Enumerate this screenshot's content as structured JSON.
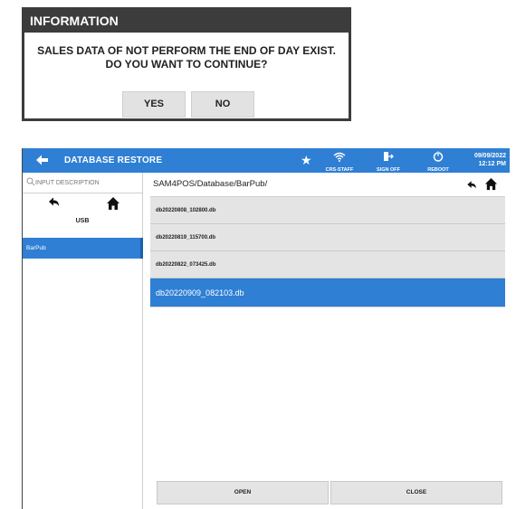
{
  "dialog": {
    "title": "INFORMATION",
    "message_line1": "SALES DATA OF NOT PERFORM THE END OF DAY EXIST.",
    "message_line2": "DO YOU WANT TO CONTINUE?",
    "yes_label": "YES",
    "no_label": "NO"
  },
  "topbar": {
    "title": "DATABASE RESTORE",
    "wifi_label": "CRS-STAFF",
    "signoff_label": "SIGN OFF",
    "reboot_label": "REBOOT",
    "date": "09/09/2022",
    "time": "12:12 PM",
    "accent_color": "#2f7fd4"
  },
  "left_panel": {
    "search_placeholder": "INPUT DESCRIPTION",
    "device_label": "USB",
    "items": [
      {
        "label": "BarPub",
        "selected": true
      }
    ]
  },
  "right_panel": {
    "path": "SAM4POS/Database/BarPub/",
    "files": [
      {
        "name": "db20220808_102800.db"
      },
      {
        "name": "db20220819_115700.db"
      },
      {
        "name": "db20220822_073425.db"
      },
      {
        "name": "db20220909_082103.db"
      }
    ],
    "open_label": "OPEN",
    "close_label": "CLOSE"
  },
  "icons": {
    "back": "arrow-left-icon",
    "star": "star-icon",
    "wifi": "wifi-icon",
    "signoff": "sign-out-icon",
    "reboot": "power-icon",
    "search": "search-icon",
    "undo": "undo-arrow-icon",
    "home": "home-icon"
  }
}
